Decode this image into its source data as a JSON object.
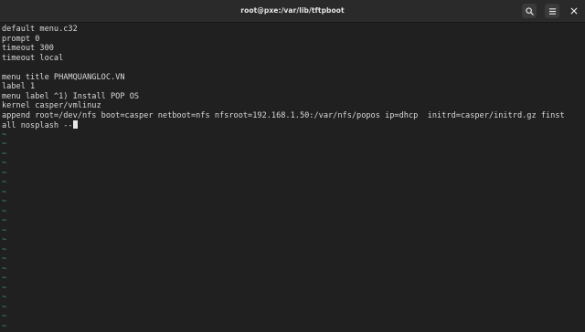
{
  "window": {
    "title": "root@pxe:/var/lib/tftpboot",
    "buttons": {
      "search_icon": "search-icon",
      "menu_icon": "hamburger-menu-icon",
      "close_icon": "close-icon"
    }
  },
  "terminal": {
    "lines": [
      "default menu.c32",
      "prompt 0",
      "timeout 300",
      "timeout local",
      "",
      "menu title PHAMQUANGLOC.VN",
      "label 1",
      "menu label ^1) Install POP OS",
      "kernel casper/vmlinuz",
      "append root=/dev/nfs boot=casper netboot=nfs nfsroot=192.168.1.50:/var/nfs/popos ip=dhcp  initrd=casper/initrd.gz finst",
      "all nosplash --"
    ],
    "empty_line_marker": "~",
    "colors": {
      "background": "#202020",
      "text": "#d8d8d8",
      "tilde": "#3f9a9a",
      "cursor": "#e8e8e8"
    }
  }
}
